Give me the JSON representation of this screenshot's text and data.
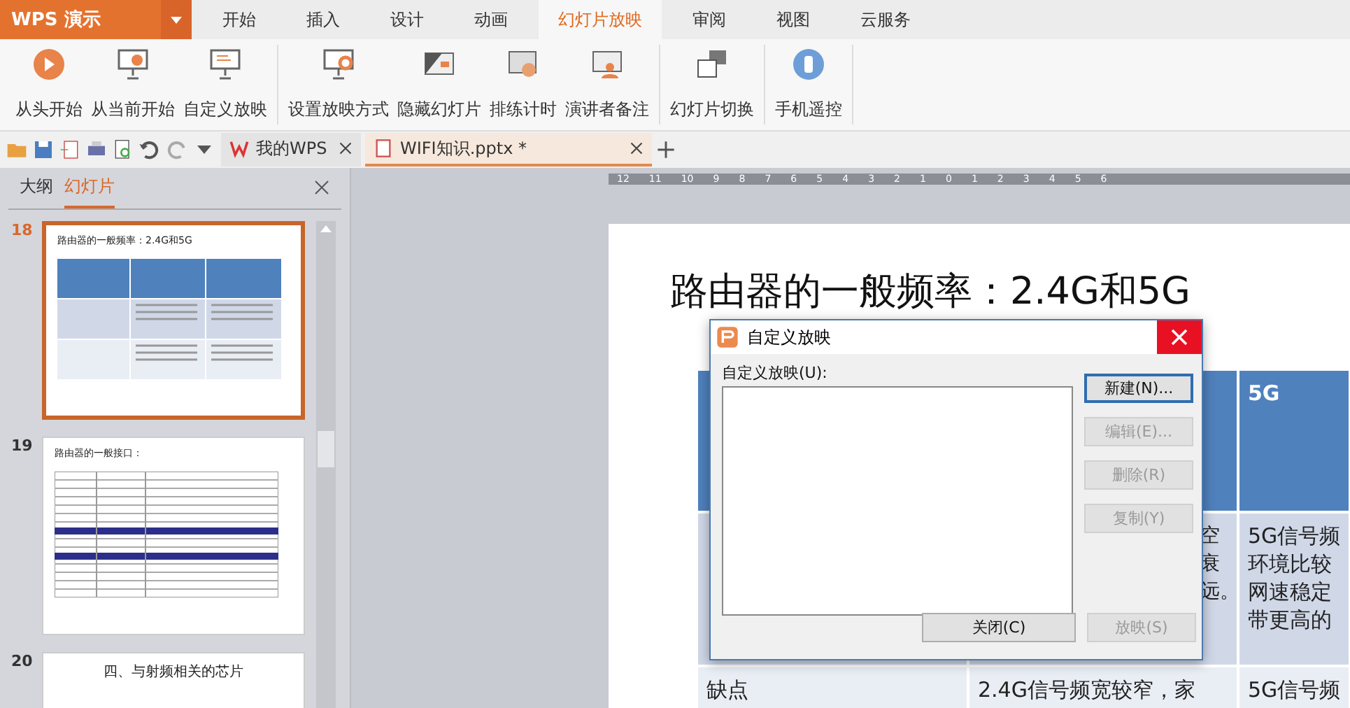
{
  "app": {
    "name": "WPS 演示"
  },
  "ribbon_tabs": [
    {
      "label": "开始",
      "selected": false
    },
    {
      "label": "插入",
      "selected": false
    },
    {
      "label": "设计",
      "selected": false
    },
    {
      "label": "动画",
      "selected": false
    },
    {
      "label": "幻灯片放映",
      "selected": true
    },
    {
      "label": "审阅",
      "selected": false
    },
    {
      "label": "视图",
      "selected": false
    },
    {
      "label": "云服务",
      "selected": false
    }
  ],
  "ribbon_groups": [
    [
      {
        "label": "从头开始",
        "kind": "play"
      },
      {
        "label": "从当前开始",
        "kind": "screen-play"
      },
      {
        "label": "自定义放映",
        "kind": "screen"
      }
    ],
    [
      {
        "label": "设置放映方式",
        "kind": "screen-gear"
      },
      {
        "label": "隐藏幻灯片",
        "kind": "hide"
      },
      {
        "label": "排练计时",
        "kind": "timer"
      },
      {
        "label": "演讲者备注",
        "kind": "presenter"
      }
    ],
    [
      {
        "label": "幻灯片切换",
        "kind": "switch"
      }
    ],
    [
      {
        "label": "手机遥控",
        "kind": "remote"
      }
    ]
  ],
  "doc_tabs": [
    {
      "label": "我的WPS",
      "kind": "home",
      "selected": false
    },
    {
      "label": "WIFI知识.pptx *",
      "kind": "doc",
      "selected": true
    }
  ],
  "panel_tabs": [
    {
      "label": "大纲",
      "selected": false
    },
    {
      "label": "幻灯片",
      "selected": true
    }
  ],
  "thumbnails": [
    {
      "number": "18",
      "title": "路由器的一般频率：2.4G和5G",
      "kind": "table",
      "selected": true
    },
    {
      "number": "19",
      "title": "路由器的一般接口：",
      "kind": "grid",
      "selected": false
    },
    {
      "number": "20",
      "title": "四、与射频相关的芯片",
      "kind": "heading",
      "selected": false
    }
  ],
  "ruler_labels": [
    "12",
    "11",
    "10",
    "9",
    "8",
    "7",
    "6",
    "5",
    "4",
    "3",
    "2",
    "1",
    "0",
    "1",
    "2",
    "3",
    "4",
    "5",
    "6"
  ],
  "slide": {
    "title": "路由器的一般频率：2.4G和5G",
    "header": [
      "5G"
    ],
    "row_1": {
      "column_2": [
        "空",
        "衰",
        "远。"
      ],
      "column_3": [
        "5G信号频",
        "环境比较",
        "网速稳定",
        "带更高的"
      ]
    },
    "row_2": {
      "column_1": "缺点",
      "column_2": "2.4G信号频宽较窄，家",
      "column_3": "5G信号频"
    }
  },
  "dialog": {
    "title": "自定义放映",
    "list_label": "自定义放映(U):",
    "buttons": [
      {
        "label": "新建(N)...",
        "disabled": false
      },
      {
        "label": "编辑(E)...",
        "disabled": true
      },
      {
        "label": "删除(R)",
        "disabled": true
      },
      {
        "label": "复制(Y)",
        "disabled": true
      }
    ],
    "footer_buttons": [
      {
        "label": "关闭(C)",
        "disabled": false
      },
      {
        "label": "放映(S)",
        "disabled": true
      }
    ]
  }
}
